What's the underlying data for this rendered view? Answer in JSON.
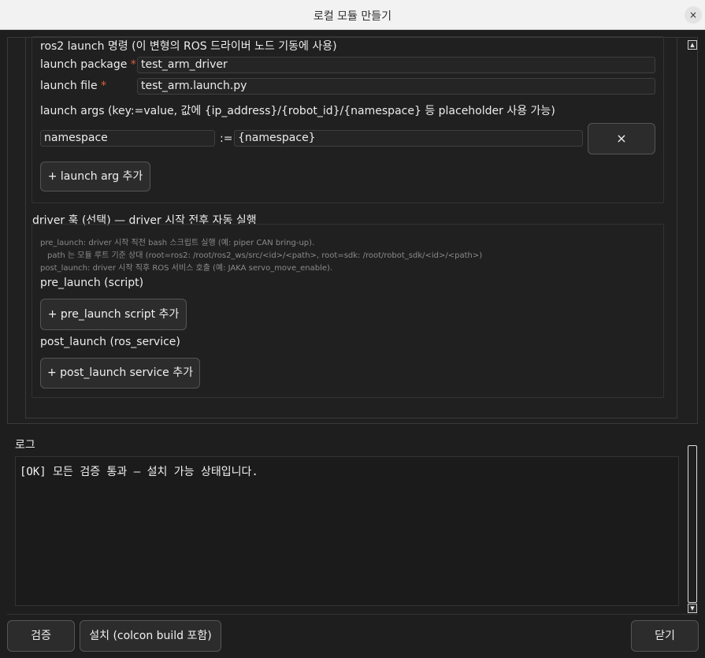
{
  "window": {
    "title": "로컬 모듈 만들기",
    "close_glyph": "×"
  },
  "launch": {
    "section_label": "ros2 launch 명령 (이 변형의 ROS 드라이버 노드 기동에 사용)",
    "package_label": "launch package",
    "package_value": "test_arm_driver",
    "file_label": "launch file",
    "file_value": "test_arm.launch.py",
    "required_mark": "*",
    "args_label": "launch args (key:=value, 값에 {ip_address}/{robot_id}/{namespace} 등 placeholder 사용 가능)",
    "args": [
      {
        "key": "namespace",
        "sep": ":=",
        "value": "{namespace}",
        "remove_glyph": "×"
      }
    ],
    "add_arg_label": "+ launch arg 추가"
  },
  "hooks": {
    "title": "driver 훅 (선택) — driver 시작 전후 자동 실행",
    "hint_lines": [
      "pre_launch: driver 시작 직전 bash 스크립트 실행 (예: piper CAN bring-up).",
      "path 는 모듈 루트 기준 상대 (root=ros2: /root/ros2_ws/src/<id>/<path>, root=sdk: /root/robot_sdk/<id>/<path>)",
      "post_launch: driver 시작 직후 ROS 서비스 호출 (예: JAKA servo_move_enable)."
    ],
    "pre_label": "pre_launch (script)",
    "pre_add_label": "+ pre_launch script 추가",
    "post_label": "post_launch (ros_service)",
    "post_add_label": "+ post_launch service 추가"
  },
  "log": {
    "title": "로그",
    "text": "[OK] 모든 검증 통과 — 설치 가능 상태입니다."
  },
  "footer": {
    "validate_label": "검증",
    "install_label": "설치 (colcon build 포함)",
    "close_label": "닫기"
  },
  "scroll": {
    "up_glyph": "▲",
    "down_glyph": "▼"
  }
}
